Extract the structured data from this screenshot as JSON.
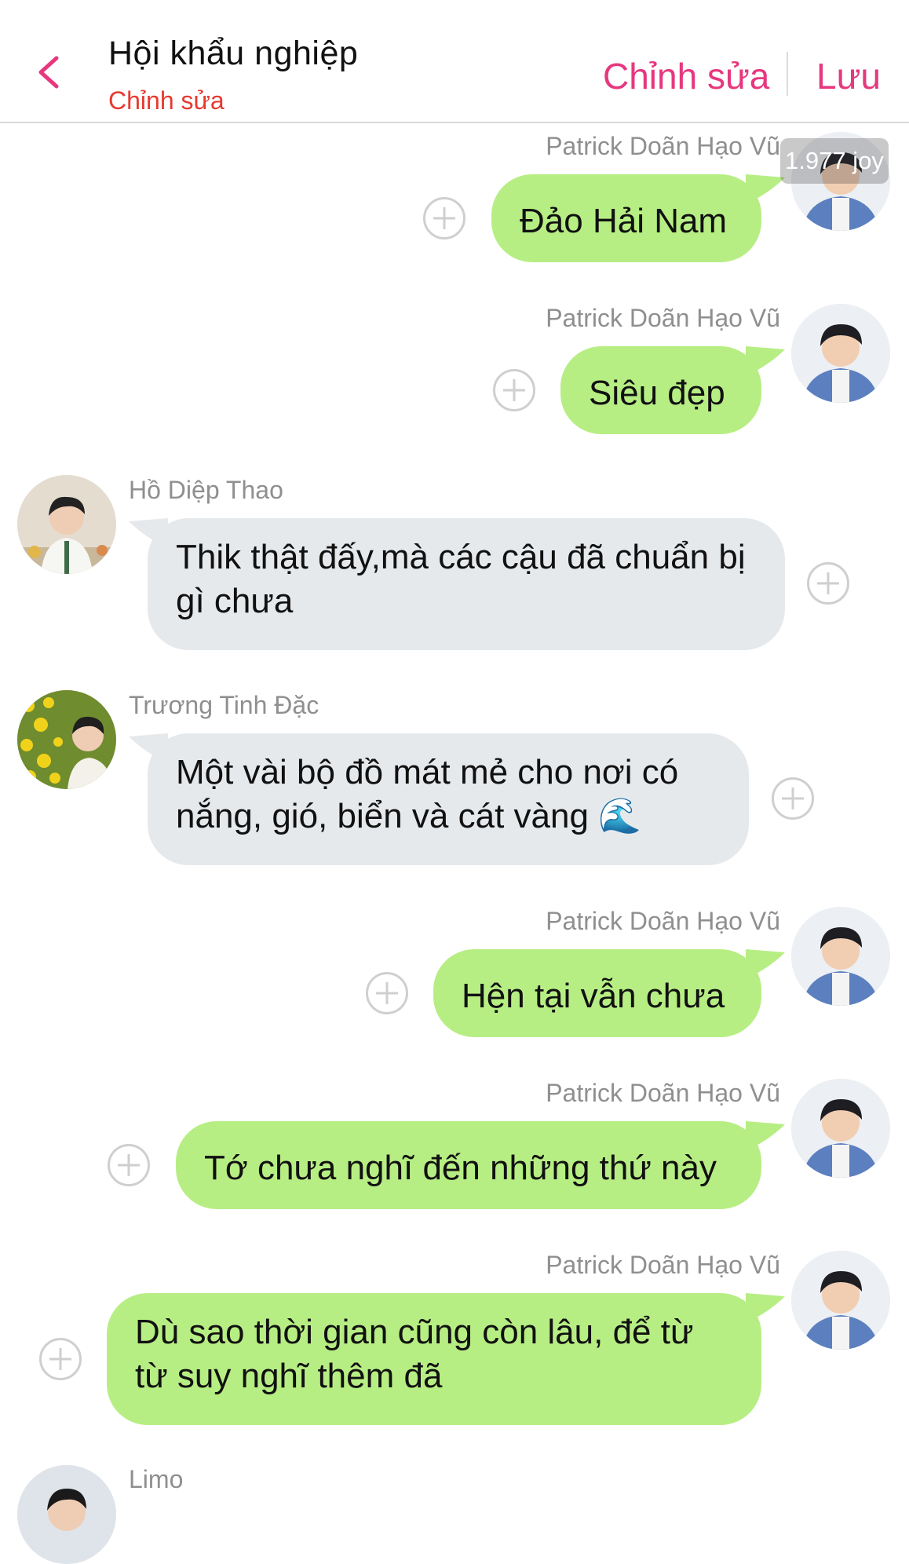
{
  "header": {
    "title": "Hội khẩu nghiệp",
    "subtitle": "Chỉnh sửa",
    "edit_label": "Chỉnh sửa",
    "save_label": "Lưu",
    "accent_color": "#e6387e",
    "subtitle_color": "#e8392f"
  },
  "overlay": {
    "joy_badge": "1.977 joy"
  },
  "messages": [
    {
      "sender": "Patrick Doãn Hạo Vũ",
      "text": "Đảo Hải Nam",
      "side": "right",
      "bubble_color": "#b7ee84"
    },
    {
      "sender": "Patrick Doãn Hạo Vũ",
      "text": "Siêu đẹp",
      "side": "right",
      "bubble_color": "#b7ee84"
    },
    {
      "sender": "Hồ Diệp Thao",
      "text": "Thik thật đấy,mà các cậu đã chuẩn bị gì chưa",
      "side": "left",
      "bubble_color": "#e6e9ec"
    },
    {
      "sender": "Trương Tinh Đặc",
      "text": "Một vài bộ đồ mát mẻ cho nơi có nắng, gió, biển và cát vàng 🌊",
      "side": "left",
      "bubble_color": "#e6e9ec"
    },
    {
      "sender": "Patrick Doãn Hạo Vũ",
      "text": "Hện tại vẫn chưa",
      "side": "right",
      "bubble_color": "#b7ee84"
    },
    {
      "sender": "Patrick Doãn Hạo Vũ",
      "text": "Tớ chưa nghĩ đến những thứ này",
      "side": "right",
      "bubble_color": "#b7ee84"
    },
    {
      "sender": "Patrick Doãn Hạo Vũ",
      "text": "Dù sao thời gian cũng còn lâu, để từ từ suy nghĩ thêm đã",
      "side": "right",
      "bubble_color": "#b7ee84"
    },
    {
      "sender": "Limo",
      "text": "",
      "side": "left",
      "bubble_color": "#e6e9ec"
    }
  ]
}
